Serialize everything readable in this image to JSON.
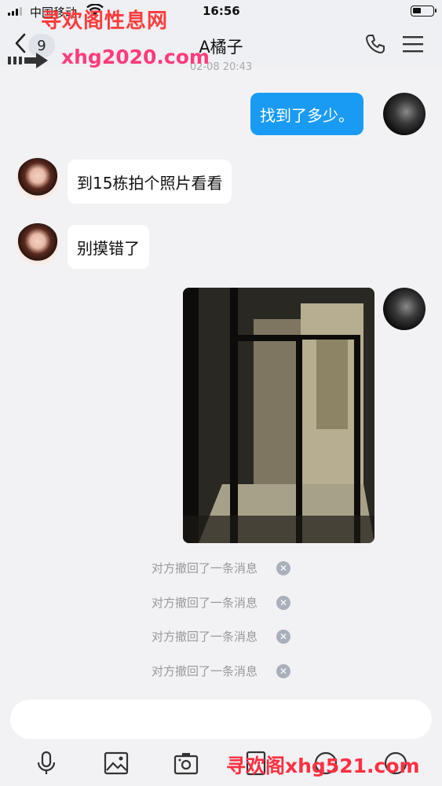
{
  "status_bar": {
    "carrier": "中国移动",
    "time": "16:56"
  },
  "nav": {
    "unread_count": "9",
    "title": "A橘子",
    "timestamp": "02-08 20:43"
  },
  "watermarks": {
    "top_text": "寻欢阁性息网",
    "top_url": "xhg2020.com",
    "bottom_text": "寻欢阁xhg521.com"
  },
  "messages": [
    {
      "sender": "self",
      "type": "text",
      "text": "找到了多少。"
    },
    {
      "sender": "other",
      "type": "text",
      "text": "到15栋拍个照片看看"
    },
    {
      "sender": "other",
      "type": "text",
      "text": "别摸错了"
    },
    {
      "sender": "self",
      "type": "image"
    }
  ],
  "recalls": [
    "对方撤回了一条消息",
    "对方撤回了一条消息",
    "对方撤回了一条消息",
    "对方撤回了一条消息"
  ],
  "input": {
    "value": "",
    "placeholder": ""
  },
  "toolbar_icons": [
    "microphone-icon",
    "photo-icon",
    "camera-icon",
    "red-packet-icon",
    "emoji-icon",
    "plus-icon"
  ],
  "colors": {
    "self_bubble": "#1a9bf3",
    "other_bubble": "#ffffff",
    "background": "#f2f2f5"
  }
}
